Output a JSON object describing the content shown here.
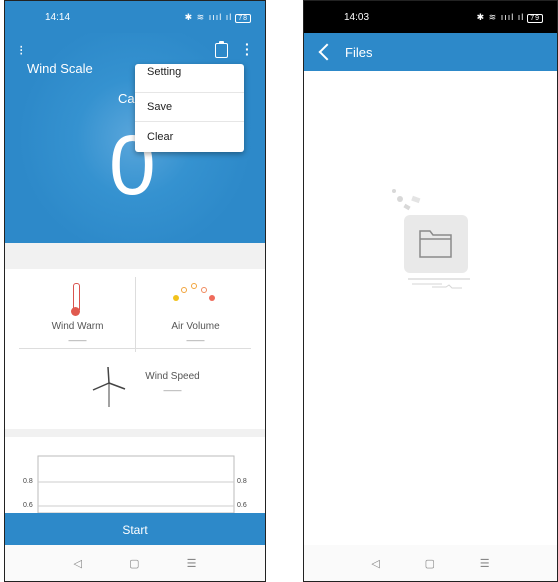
{
  "left": {
    "status": {
      "time": "14:14",
      "battery": "78"
    },
    "app_title": "Wind Scale",
    "hero_partial_text": "Ca",
    "reading": "0",
    "menu": [
      "Setting",
      "Save",
      "Clear"
    ],
    "cards": [
      {
        "label": "Wind Warm",
        "value": "——"
      },
      {
        "label": "Air Volume",
        "value": "——"
      },
      {
        "label": "Wind Speed",
        "value": "——"
      }
    ],
    "chart": {
      "y_ticks": [
        "0.8",
        "0.6"
      ]
    },
    "start_label": "Start",
    "nav": {
      "back": "◁",
      "home": "▢",
      "menu": "☰"
    }
  },
  "right": {
    "status": {
      "time": "14:03",
      "battery": "79"
    },
    "title": "Files",
    "nav": {
      "back": "◁",
      "home": "▢",
      "menu": "☰"
    }
  },
  "colors": {
    "primary": "#2d89c9",
    "status_dark": "#000000"
  },
  "icons": [
    "menu-icon",
    "clipboard-icon",
    "more-vert-icon",
    "thermometer-icon",
    "air-volume-icon",
    "wind-turbine-icon",
    "back-arrow-icon",
    "empty-folder-icon"
  ]
}
